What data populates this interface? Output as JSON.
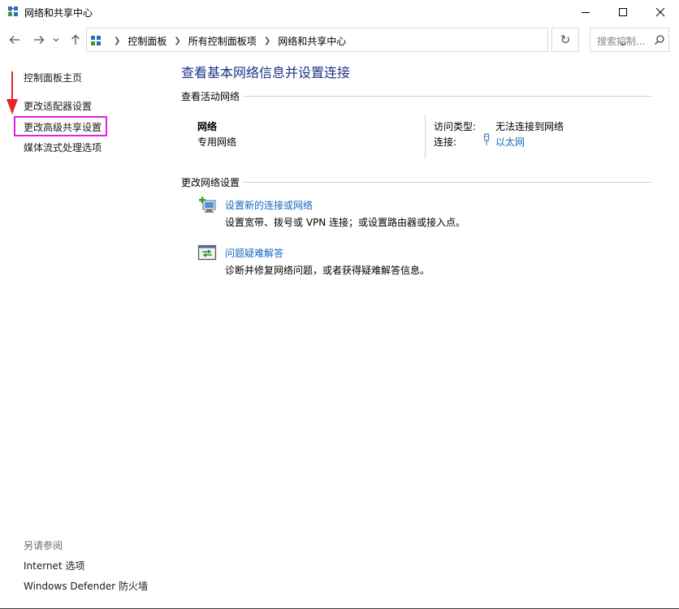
{
  "window": {
    "title": "网络和共享中心",
    "minimize_icon": "minimize-icon",
    "maximize_icon": "maximize-icon",
    "close_icon": "close-icon"
  },
  "navigation": {
    "breadcrumbs": [
      "控制面板",
      "所有控制面板项",
      "网络和共享中心"
    ],
    "search_placeholder": "搜索控制..."
  },
  "sidebar": {
    "home_label": "控制面板主页",
    "links": [
      "更改适配器设置",
      "更改高级共享设置",
      "媒体流式处理选项"
    ],
    "see_also_label": "另请参阅",
    "see_also_links": [
      "Internet 选项",
      "Windows Defender 防火墙"
    ],
    "highlight_color": "#e020e6",
    "arrow_color": "#e8262a"
  },
  "main": {
    "title": "查看基本网络信息并设置连接",
    "active_section": "查看活动网络",
    "network": {
      "name": "网络",
      "category": "专用网络",
      "access_type_label": "访问类型:",
      "access_type_value": "无法连接到网络",
      "connection_label": "连接:",
      "connection_value": "以太网"
    },
    "change_section": "更改网络设置",
    "tasks": [
      {
        "icon": "new-connection-icon",
        "title": "设置新的连接或网络",
        "desc": "设置宽带、拨号或 VPN 连接；或设置路由器或接入点。"
      },
      {
        "icon": "troubleshoot-icon",
        "title": "问题疑难解答",
        "desc": "诊断并修复网络问题，或者获得疑难解答信息。"
      }
    ],
    "title_color": "#1e3287",
    "link_color": "#1567c4"
  }
}
